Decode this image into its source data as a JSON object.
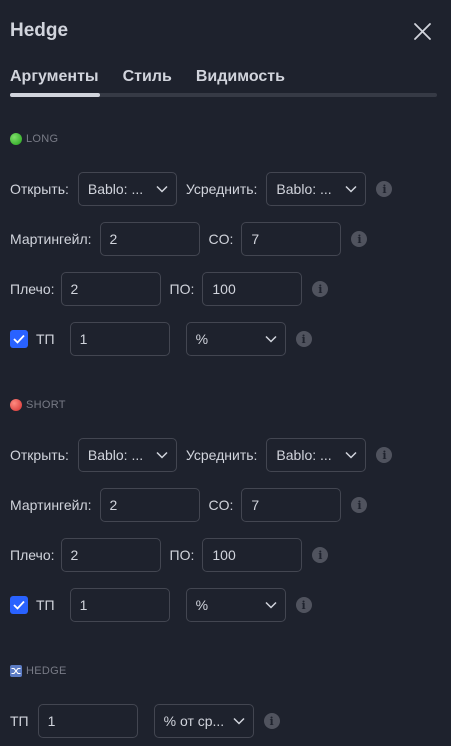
{
  "dialog": {
    "title": "Hedge"
  },
  "tabs": [
    {
      "label": "Аргументы",
      "active": true
    },
    {
      "label": "Стиль",
      "active": false
    },
    {
      "label": "Видимость",
      "active": false
    }
  ],
  "long": {
    "label": "LONG",
    "open_label": "Открыть:",
    "open_value": "Bablo: ...",
    "average_label": "Усреднить:",
    "average_value": "Bablo: ...",
    "martingale_label": "Мартингейл:",
    "martingale_value": "2",
    "co_label": "CO:",
    "co_value": "7",
    "leverage_label": "Плечо:",
    "leverage_value": "2",
    "po_label": "ПО:",
    "po_value": "100",
    "tp_label": "ТП",
    "tp_checked": true,
    "tp_value": "1",
    "tp_unit": "%"
  },
  "short": {
    "label": "SHORT",
    "open_label": "Открыть:",
    "open_value": "Bablo: ...",
    "average_label": "Усреднить:",
    "average_value": "Bablo: ...",
    "martingale_label": "Мартингейл:",
    "martingale_value": "2",
    "co_label": "CO:",
    "co_value": "7",
    "leverage_label": "Плечо:",
    "leverage_value": "2",
    "po_label": "ПО:",
    "po_value": "100",
    "tp_label": "ТП",
    "tp_checked": true,
    "tp_value": "1",
    "tp_unit": "%"
  },
  "hedge": {
    "label": "HEDGE",
    "tp_label": "ТП",
    "tp_value": "1",
    "tp_unit": "% от ср..."
  },
  "info_glyph": "i",
  "colors": {
    "background": "#1e222d",
    "accent": "#2962ff",
    "border": "#434651",
    "text": "#d1d4dc",
    "muted": "#787b86"
  }
}
